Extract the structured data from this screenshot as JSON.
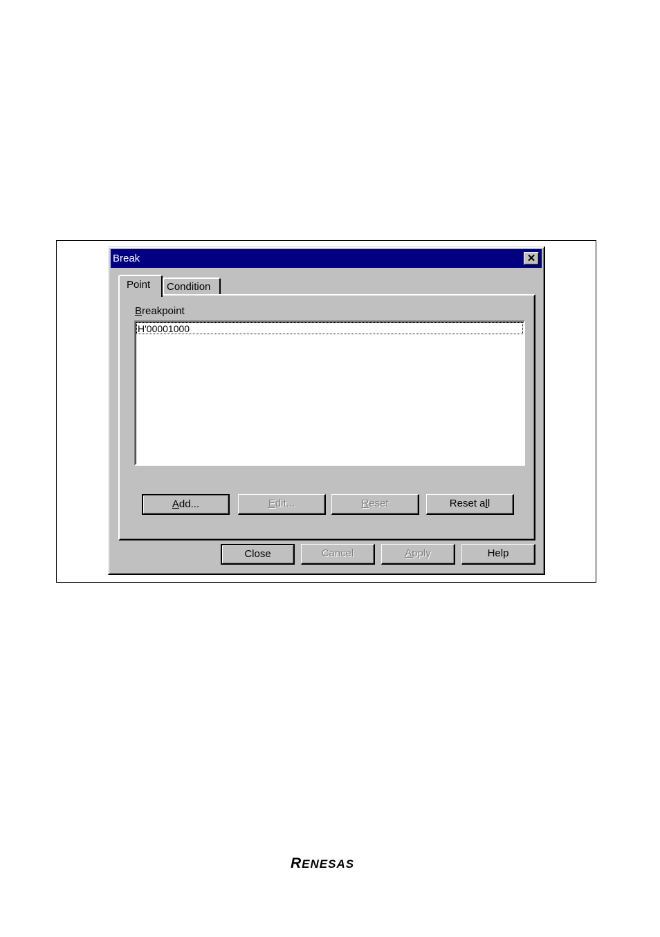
{
  "dialog": {
    "title": "Break",
    "close_icon": "close-x-icon"
  },
  "tabs": [
    {
      "label": "Point",
      "active": true
    },
    {
      "label": "Condition",
      "active": false
    }
  ],
  "breakpoint_panel": {
    "label_mnemonic": "B",
    "label_rest": "reakpoint",
    "items": [
      "H'00001000"
    ]
  },
  "panel_buttons": [
    {
      "mnemonic": "A",
      "rest": "dd...",
      "enabled": true
    },
    {
      "mnemonic": "E",
      "rest": "dit...",
      "enabled": false
    },
    {
      "mnemonic": "R",
      "rest": "eset",
      "enabled": false
    },
    {
      "pre": "Reset a",
      "mnemonic": "l",
      "rest": "l",
      "enabled": true
    }
  ],
  "dialog_buttons": [
    {
      "label": "Close",
      "enabled": true
    },
    {
      "label": "Cancel",
      "enabled": false
    },
    {
      "mnemonic": "A",
      "rest": "pply",
      "enabled": false
    },
    {
      "label": "Help",
      "enabled": true
    }
  ],
  "footer": {
    "logo_first": "R",
    "logo_rest": "ENESAS"
  }
}
